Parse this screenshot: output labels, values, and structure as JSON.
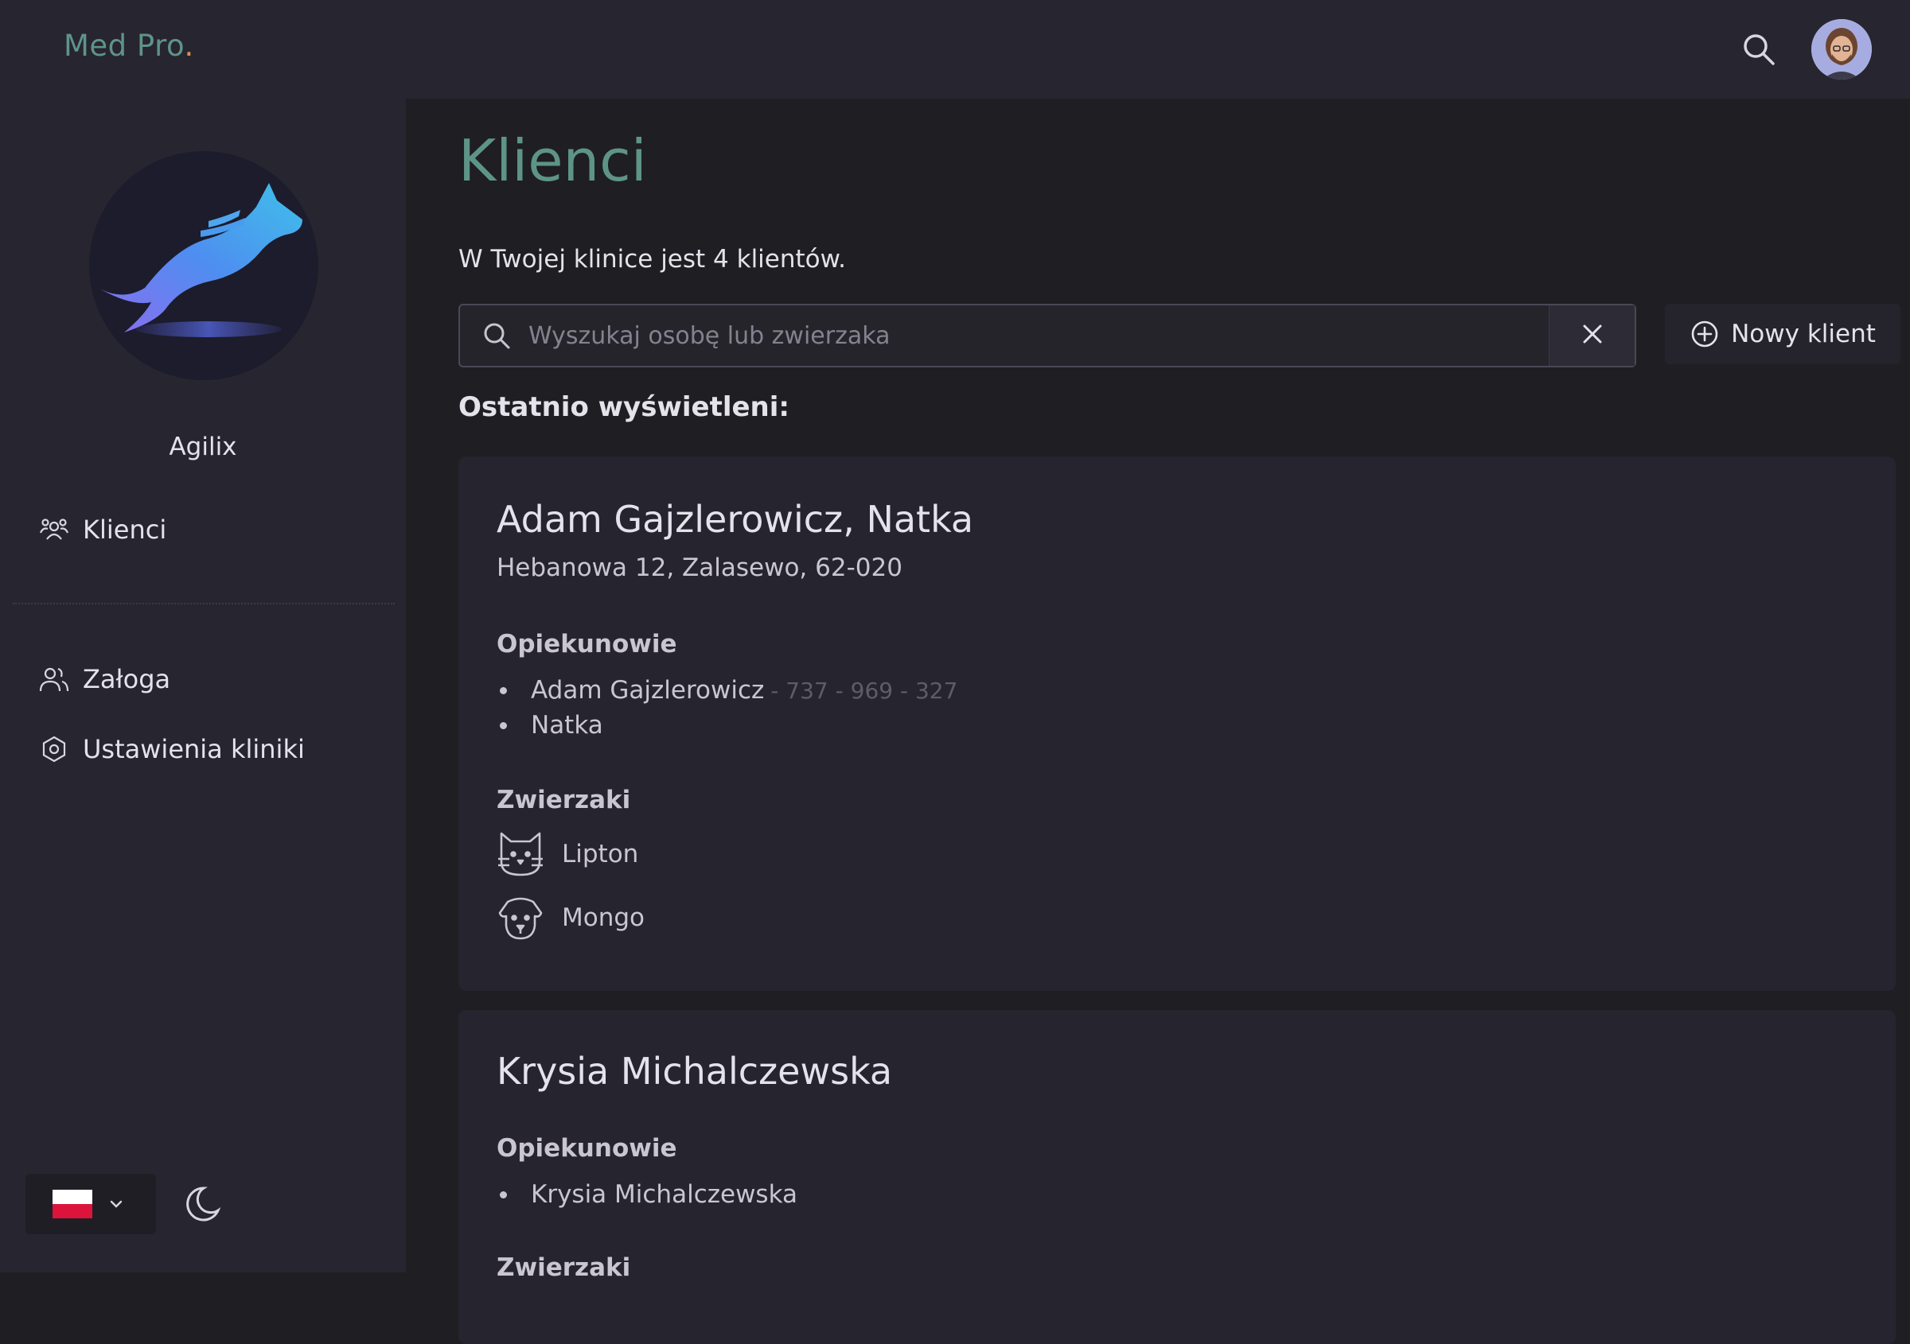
{
  "app": {
    "brand": "Med Pro",
    "brand_dot": "."
  },
  "colors": {
    "accent": "#5e9488",
    "brand_dot": "#e0914a",
    "sidebar_bg": "#27252f",
    "main_bg": "#1f1e23",
    "card_bg": "#26242f"
  },
  "topbar": {
    "search_icon": "search-icon",
    "avatar": "user-avatar"
  },
  "sidebar": {
    "clinic_name": "Agilix",
    "items": [
      {
        "label": "Klienci",
        "icon": "clients-icon"
      },
      {
        "label": "Załoga",
        "icon": "team-icon"
      },
      {
        "label": "Ustawienia kliniki",
        "icon": "settings-icon"
      }
    ],
    "language": {
      "selected": "PL",
      "icon": "poland-flag-icon"
    },
    "theme_icon": "moon-icon"
  },
  "main": {
    "title": "Klienci",
    "subtitle": "W Twojej klinice jest 4 klientów.",
    "search": {
      "placeholder": "Wyszukaj osobę lub zwierzaka",
      "value": ""
    },
    "new_client_label": "Nowy klient",
    "recent_title": "Ostatnio wyświetleni:",
    "cards": [
      {
        "name": "Adam Gajzlerowicz, Natka",
        "address": "Hebanowa 12, Zalasewo, 62-020",
        "guardians_title": "Opiekunowie",
        "guardians": [
          {
            "name": "Adam Gajzlerowicz",
            "phone": "- 737 - 969 - 327"
          },
          {
            "name": "Natka",
            "phone": ""
          }
        ],
        "pets_title": "Zwierzaki",
        "pets": [
          {
            "name": "Lipton",
            "icon": "cat-icon"
          },
          {
            "name": "Mongo",
            "icon": "dog-icon"
          }
        ]
      },
      {
        "name": "Krysia Michalczewska",
        "guardians_title": "Opiekunowie",
        "guardians": [
          {
            "name": "Krysia Michalczewska"
          }
        ],
        "pets_title": "Zwierzaki"
      }
    ]
  }
}
